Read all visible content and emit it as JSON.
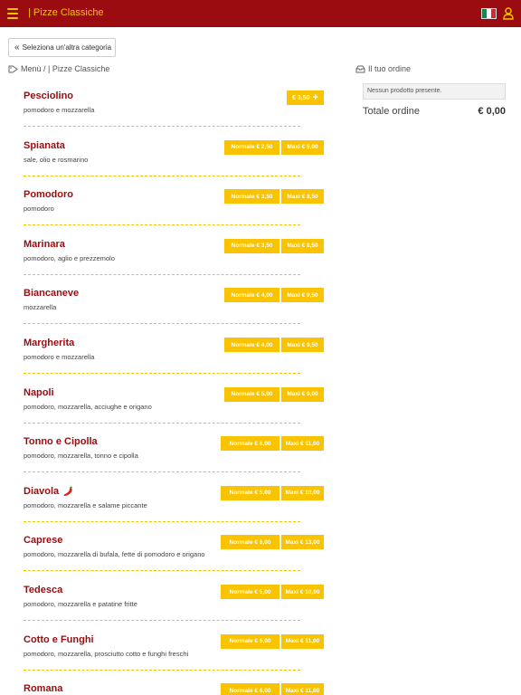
{
  "header": {
    "title": "| Pizze Classiche",
    "flag_colors": [
      "#009246",
      "#ffffff",
      "#ce2b37"
    ]
  },
  "nav": {
    "back_label": "Seleziona un'altra categoria",
    "breadcrumb": "Menù / | Pizze Classiche"
  },
  "order": {
    "heading": "Il tuo ordine",
    "empty_text": "Nessun prodotto presente.",
    "total_label": "Totale ordine",
    "total_value": "€ 0,00"
  },
  "colors": {
    "header_bg": "#9a0c10",
    "accent": "#f9c300",
    "item_name": "#9a0c10"
  },
  "items": [
    {
      "name": "Pesciolino",
      "desc": "pomodoro e mozzarella",
      "single_price": "€ 3,50"
    },
    {
      "name": "Spianata",
      "desc": "sale, olio e rosmarino",
      "normale": "Normale € 2,50",
      "maxi": "Maxi € 5,00"
    },
    {
      "name": "Pomodoro",
      "desc": "pomodoro",
      "normale": "Normale € 3,50",
      "maxi": "Maxi € 8,50"
    },
    {
      "name": "Marinara",
      "desc": "pomodoro, aglio e prezzemolo",
      "normale": "Normale € 3,50",
      "maxi": "Maxi € 8,50"
    },
    {
      "name": "Biancaneve",
      "desc": "mozzarella",
      "normale": "Normale € 4,00",
      "maxi": "Maxi € 9,50"
    },
    {
      "name": "Margherita",
      "desc": "pomodoro e mozzarella",
      "normale": "Normale € 4,00",
      "maxi": "Maxi € 9,50"
    },
    {
      "name": "Napoli",
      "desc": "pomodoro, mozzarella, acciughe e origano",
      "normale": "Normale € 5,00",
      "maxi": "Maxi € 9,00"
    },
    {
      "name": "Tonno e Cipolla",
      "desc": "pomodoro, mozzarella, tonno e cipolla",
      "normale": "Normale € 6,00",
      "maxi": "Maxi € 11,00"
    },
    {
      "name": "Diavola",
      "desc": "pomodoro, mozzarella e salame piccante",
      "normale": "Normale € 5,00",
      "maxi": "Maxi € 10,00",
      "spicy": true
    },
    {
      "name": "Caprese",
      "desc": "pomodoro, mozzarella di bufala, fette di pomodoro e origano",
      "normale": "Normale € 6,00",
      "maxi": "Maxi € 13,00"
    },
    {
      "name": "Tedesca",
      "desc": "pomodoro, mozzarella e patatine fritte",
      "normale": "Normale € 5,00",
      "maxi": "Maxi € 10,00"
    },
    {
      "name": "Cotto e Funghi",
      "desc": "pomodoro, mozzarella, prosciutto cotto e funghi freschi",
      "normale": "Normale € 6,00",
      "maxi": "Maxi € 11,00"
    },
    {
      "name": "Romana",
      "desc": "",
      "normale": "Normale € 6,00",
      "maxi": "Maxi € 11,00"
    }
  ]
}
